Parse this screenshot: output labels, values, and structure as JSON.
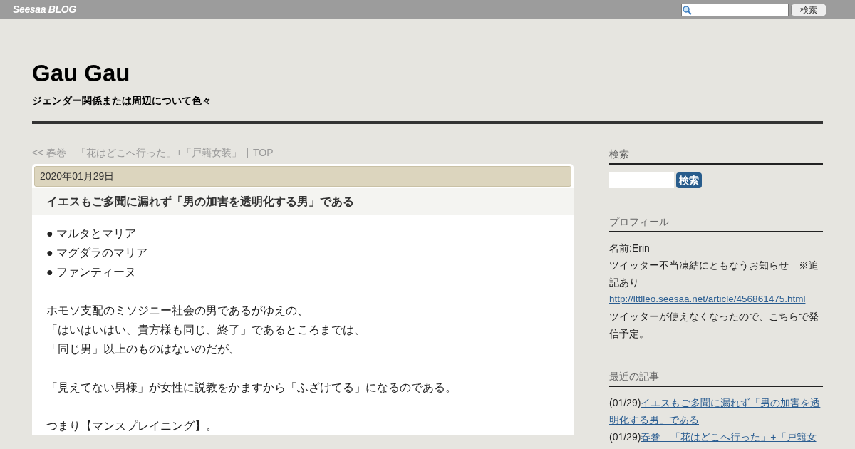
{
  "topbar": {
    "logo": "Seesaa BLOG",
    "search_button": "検索"
  },
  "blog": {
    "title": "Gau Gau",
    "subtitle": "ジェンダー関係または周辺について色々"
  },
  "nav": {
    "prev": "<< 春巻　「花はどこへ行った」+「戸籍女装」",
    "separator": "|",
    "top": "TOP"
  },
  "article": {
    "date": "2020年01月29日",
    "title": "イエスもご多聞に漏れず「男の加害を透明化する男」である",
    "paragraphs": [
      [
        "● マルタとマリア",
        "● マグダラのマリア",
        "● ファンティーヌ"
      ],
      [
        "ホモソ支配のミソジニー社会の男であるがゆえの、",
        "「はいはいはい、貴方様も同じ、終了」であるところまでは、",
        "「同じ男」以上のものはないのだが、"
      ],
      [
        "「見えてない男様」が女性に説教をかますから「ふざけてる」になるのである。"
      ],
      [
        "つまり【マンスプレイニング】。"
      ]
    ]
  },
  "sidebar": {
    "search": {
      "heading": "検索",
      "button": "検索"
    },
    "profile": {
      "heading": "プロフィール",
      "name": "名前:Erin",
      "notice": "ツイッター不当凍結にともなうお知らせ　※追記あり",
      "link": "http://lttlleo.seesaa.net/article/456861475.html",
      "note": "ツイッターが使えなくなったので、こちらで発信予定。"
    },
    "recent": {
      "heading": "最近の記事",
      "items": [
        {
          "date": "(01/29)",
          "title": "イエスもご多聞に漏れず「男の加害を透明化する男」である"
        },
        {
          "date": "(01/29)",
          "title": "春巻　「花はどこへ行った」+「戸籍女"
        }
      ]
    }
  }
}
